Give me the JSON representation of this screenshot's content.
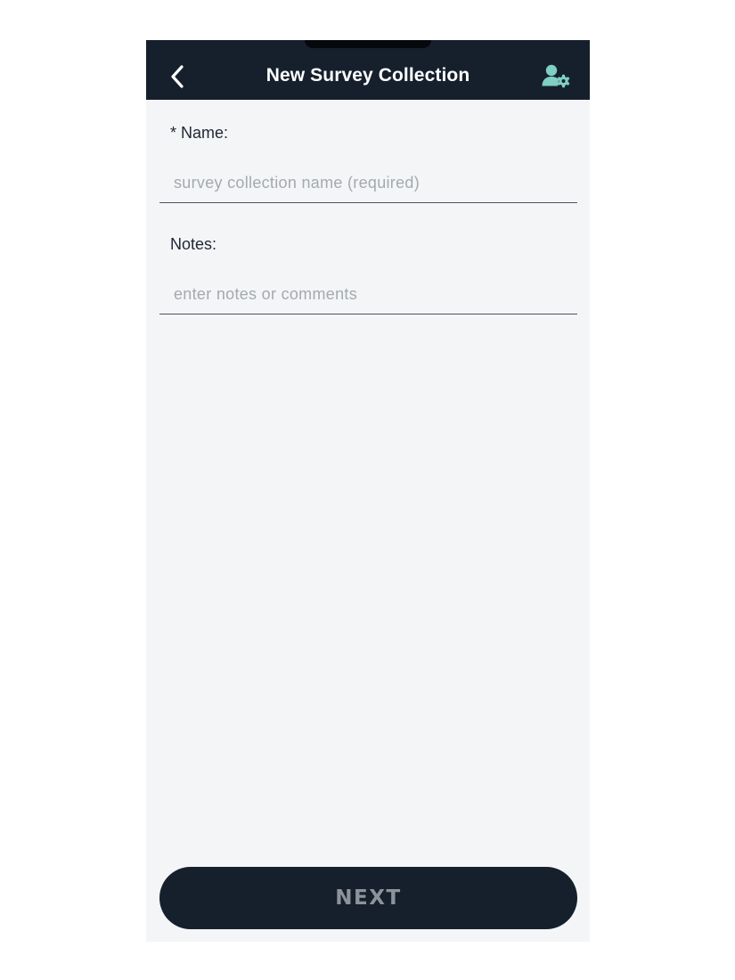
{
  "header": {
    "title": "New Survey Collection",
    "back_icon": "chevron-left-icon",
    "settings_icon": "user-gear-icon",
    "accent_color": "#7fcfc4",
    "background_color": "#16202d"
  },
  "form": {
    "name": {
      "label": "* Name:",
      "value": "",
      "placeholder": "survey collection name (required)"
    },
    "notes": {
      "label": "Notes:",
      "value": "",
      "placeholder": "enter notes or comments"
    }
  },
  "footer": {
    "next_label": "NEXT"
  }
}
